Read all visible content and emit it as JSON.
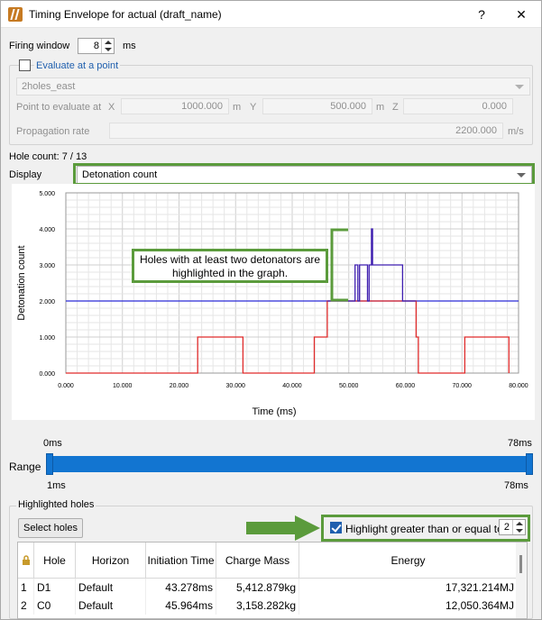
{
  "window": {
    "title": "Timing Envelope for actual",
    "subtitle": "(draft_name)",
    "help_label": "?",
    "close_label": "✕"
  },
  "firing": {
    "label": "Firing window",
    "value": "8",
    "unit": "ms"
  },
  "evaluate": {
    "label": "Evaluate at a point",
    "checked": false,
    "point_name": "2holes_east",
    "point_label": "Point to evaluate at",
    "x_label": "X",
    "x_value": "1000.000",
    "x_unit": "m",
    "y_label": "Y",
    "y_value": "500.000",
    "y_unit": "m",
    "z_label": "Z",
    "z_value": "0.000",
    "rate_label": "Propagation rate",
    "rate_value": "2200.000",
    "rate_unit": "m/s"
  },
  "hole_count": "Hole count: 7 / 13",
  "display": {
    "label": "Display",
    "value": "Detonation count"
  },
  "annotation": {
    "callout": "Holes with at least two detonators are highlighted in the graph."
  },
  "chart_data": {
    "type": "line",
    "xlabel": "Time (ms)",
    "ylabel": "Detonation count",
    "xlim": [
      0,
      80
    ],
    "ylim": [
      0,
      5
    ],
    "x_ticks": [
      "0.000",
      "10.000",
      "20.000",
      "30.000",
      "40.000",
      "50.000",
      "60.000",
      "70.000",
      "80.000"
    ],
    "y_ticks": [
      "0.000",
      "1.000",
      "2.000",
      "3.000",
      "4.000",
      "5.000"
    ],
    "threshold": {
      "value": 2,
      "color": "#2b2bd6"
    },
    "series": [
      {
        "color": "#e02b2b",
        "points": [
          [
            0,
            0
          ],
          [
            23.3,
            0
          ],
          [
            23.3,
            1
          ],
          [
            31.3,
            1
          ],
          [
            31.3,
            0
          ],
          [
            43.9,
            0
          ],
          [
            43.9,
            1
          ],
          [
            46.2,
            1
          ],
          [
            46.2,
            2
          ],
          [
            51.9,
            2
          ],
          [
            51.9,
            2
          ],
          [
            54.2,
            2
          ],
          [
            54.2,
            2
          ],
          [
            59.5,
            2
          ],
          [
            59.5,
            2
          ],
          [
            61.9,
            2
          ],
          [
            61.9,
            1
          ],
          [
            62.3,
            1
          ],
          [
            62.3,
            0
          ],
          [
            70.5,
            0
          ],
          [
            70.5,
            1
          ],
          [
            78.3,
            1
          ],
          [
            78.3,
            0
          ]
        ]
      },
      {
        "color": "#3f1fb0",
        "points": [
          [
            46.2,
            2
          ],
          [
            51.1,
            2
          ],
          [
            51.1,
            3
          ],
          [
            51.6,
            3
          ],
          [
            51.6,
            2
          ],
          [
            51.9,
            2
          ],
          [
            51.9,
            3
          ],
          [
            53.3,
            3
          ],
          [
            53.3,
            2
          ],
          [
            53.6,
            2
          ],
          [
            53.6,
            3
          ],
          [
            54.0,
            3
          ],
          [
            54.0,
            4
          ],
          [
            54.2,
            4
          ],
          [
            54.2,
            3
          ],
          [
            59.5,
            3
          ],
          [
            59.5,
            2
          ],
          [
            61.9,
            2
          ]
        ]
      }
    ]
  },
  "range": {
    "label": "Range",
    "min_label": "0ms",
    "max_label": "78ms",
    "low_label": "1ms",
    "high_label": "78ms",
    "low_fraction": 0.0,
    "high_fraction": 1.0
  },
  "highlighted": {
    "group_label": "Highlighted holes",
    "select_button": "Select holes",
    "highlight_label": "Highlight greater than or equal to",
    "highlight_checked": true,
    "threshold_value": "2",
    "columns": [
      "Hole",
      "Horizon",
      "Initiation Time",
      "Charge Mass",
      "Energy"
    ],
    "rows": [
      {
        "num": "1",
        "hole": "D1",
        "horizon": "Default",
        "time": "43.278ms",
        "mass": "5,412.879kg",
        "energy": "17,321.214MJ"
      },
      {
        "num": "2",
        "hole": "C0",
        "horizon": "Default",
        "time": "45.964ms",
        "mass": "3,158.282kg",
        "energy": "12,050.364MJ"
      }
    ]
  }
}
